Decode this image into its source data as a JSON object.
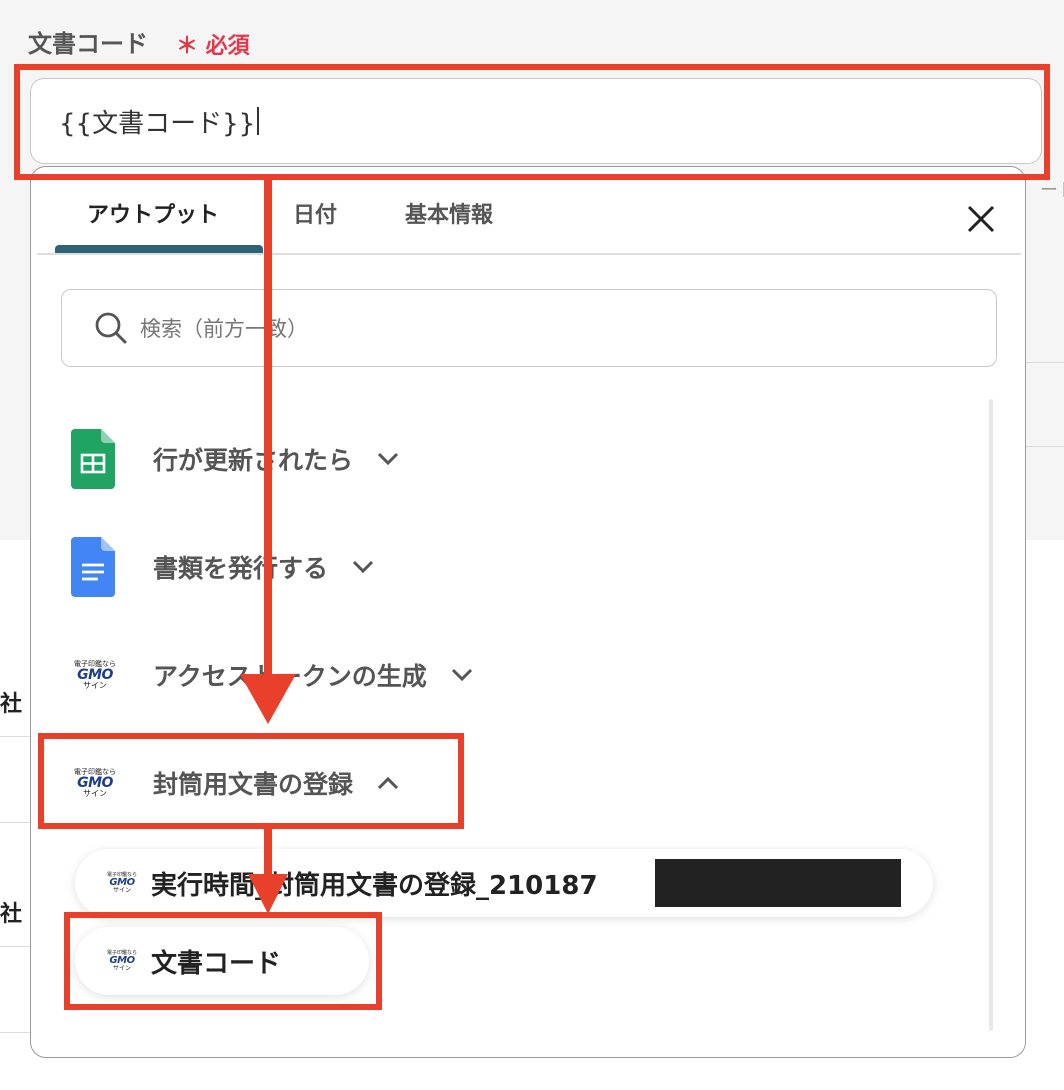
{
  "field": {
    "label": "文書コード",
    "required_mark": "＊ 必須",
    "value": "{{文書コード}}"
  },
  "background": {
    "hint_text": "ード",
    "row_labels": [
      "社",
      "社"
    ]
  },
  "panel": {
    "tabs": [
      {
        "label": "アウトプット",
        "active": true
      },
      {
        "label": "日付",
        "active": false
      },
      {
        "label": "基本情報",
        "active": false
      }
    ],
    "close_icon": "close-icon",
    "search": {
      "placeholder": "検索（前方一致）",
      "icon": "search-icon"
    },
    "groups": [
      {
        "label": "行が更新されたら",
        "icon": "google-sheets-icon",
        "expanded": false
      },
      {
        "label": "書類を発行する",
        "icon": "google-docs-icon",
        "expanded": false
      },
      {
        "label": "アクセストークンの生成",
        "icon": "gmo-sign-icon",
        "expanded": false
      },
      {
        "label": "封筒用文書の登録",
        "icon": "gmo-sign-icon",
        "expanded": true
      }
    ],
    "outputs": [
      {
        "label": "実行時間_封筒用文書の登録_210187",
        "icon": "gmo-sign-icon",
        "redacted": true
      },
      {
        "label": "文書コード",
        "icon": "gmo-sign-icon",
        "redacted": false
      }
    ],
    "gmo_logo": {
      "top": "電子印鑑なら",
      "main": "GMO",
      "bottom": "サイン"
    }
  },
  "colors": {
    "annotation_red": "#e8402a",
    "tab_underline": "#2e6377",
    "required": "#e2384a",
    "sheets_green": "#1fa463",
    "docs_blue": "#4285f4"
  }
}
